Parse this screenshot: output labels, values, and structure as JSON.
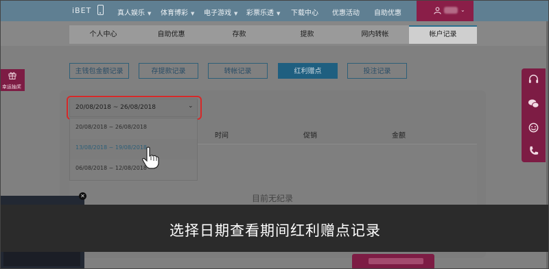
{
  "header": {
    "logo": "iBET",
    "nav": [
      {
        "label": "真人娱乐",
        "caret": true
      },
      {
        "label": "体育博彩",
        "caret": true
      },
      {
        "label": "电子游戏",
        "caret": true
      },
      {
        "label": "彩票乐透",
        "caret": true
      },
      {
        "label": "下载中心",
        "caret": false
      },
      {
        "label": "优惠活动",
        "caret": false
      },
      {
        "label": "自助优惠",
        "caret": false
      }
    ],
    "user_caret": "⌄"
  },
  "subtabs": [
    {
      "label": "个人中心"
    },
    {
      "label": "自助优惠"
    },
    {
      "label": "存款"
    },
    {
      "label": "提款"
    },
    {
      "label": "网内转帐"
    },
    {
      "label": "帐户记录",
      "active": true
    }
  ],
  "record_buttons": [
    {
      "label": "主钱包金额记录"
    },
    {
      "label": "存提款记录"
    },
    {
      "label": "转帐记录"
    },
    {
      "label": "红利赠点",
      "active": true
    },
    {
      "label": "投注记录"
    }
  ],
  "left_widget": {
    "label": "幸运抽奖",
    "icon": "gift-icon"
  },
  "right_widget_icons": [
    "headset-icon",
    "chat-icon",
    "smile-icon",
    "phone-call-icon"
  ],
  "date_filter": {
    "selected": "20/08/2018 ~ 26/08/2018",
    "options": [
      {
        "label": "20/08/2018 ~ 26/08/2018"
      },
      {
        "label": "13/08/2018 ~ 19/08/2018",
        "hovered": true
      },
      {
        "label": "06/08/2018 ~ 12/08/2018"
      }
    ]
  },
  "table": {
    "columns": [
      "时间",
      "促销",
      "金额"
    ],
    "empty_text": "目前无纪录"
  },
  "caption": "选择日期查看期间红利赠点记录",
  "colors": {
    "highlight_border": "#d62828",
    "brand_accent": "#7d1c44",
    "nav_bg": "#5f7f92"
  }
}
